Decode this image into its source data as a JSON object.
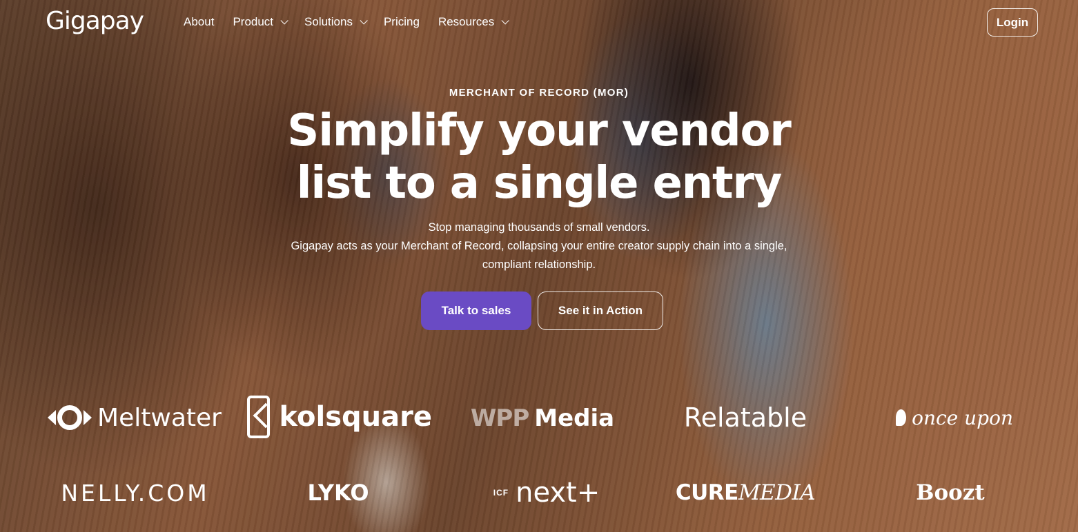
{
  "brand": {
    "name": "Gigapay"
  },
  "nav": {
    "items": [
      {
        "label": "About",
        "has_dropdown": false
      },
      {
        "label": "Product",
        "has_dropdown": true
      },
      {
        "label": "Solutions",
        "has_dropdown": true
      },
      {
        "label": "Pricing",
        "has_dropdown": false
      },
      {
        "label": "Resources",
        "has_dropdown": true
      }
    ],
    "login_label": "Login"
  },
  "hero": {
    "eyebrow": "MERCHANT OF RECORD (MOR)",
    "headline_line1": "Simplify your vendor",
    "headline_line2": "list to a single entry",
    "sub_line1": "Stop managing thousands of small vendors.",
    "sub_line2": "Gigapay acts as your Merchant of Record, collapsing your entire creator supply chain into a single,",
    "sub_line3": "compliant relationship.",
    "cta_primary": "Talk to sales",
    "cta_secondary": "See it in Action"
  },
  "clients": {
    "meltwater": "Meltwater",
    "kolsquare": "kolsquare",
    "wpp_prefix": "WPP",
    "wpp_suffix": "Media",
    "relatable": "Relatable",
    "onceupon": "once upon",
    "nelly": "NELLY.COM",
    "lyko": "LYKO",
    "icf_prefix": "ICF",
    "icf_main": "next",
    "cure_a": "CURE",
    "cure_b": "MEDIA",
    "boozt": "Boozt"
  },
  "colors": {
    "primary_button": "#6a4bc4",
    "text": "#ffffff"
  }
}
